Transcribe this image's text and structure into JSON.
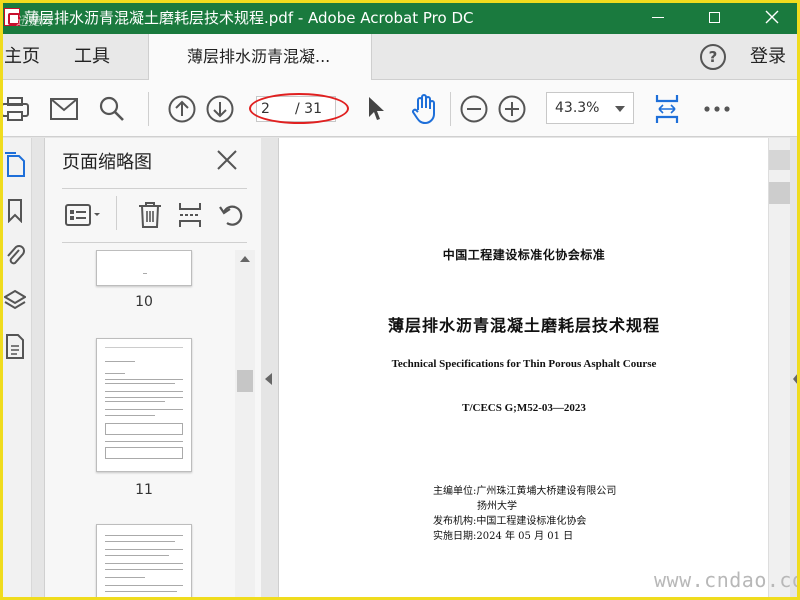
{
  "window": {
    "title": "薄层排水沥青混凝土磨耗层技术规程.pdf - Adobe Acrobat Pro DC",
    "logo_text": "迅捷网"
  },
  "menubar": {
    "home_label": "主页",
    "tools_label": "工具",
    "doc_tab_label": "薄层排水沥青混凝...",
    "help_label": "?",
    "login_label": "登录"
  },
  "toolbar": {
    "current_page": "2",
    "total_pages": "/ 31",
    "zoom": "43.3%"
  },
  "thumbnails_panel": {
    "title": "页面缩略图",
    "items": [
      {
        "label": "10"
      },
      {
        "label": "11"
      }
    ]
  },
  "document": {
    "line1": "中国工程建设标准化协会标准",
    "title_cn": "薄层排水沥青混凝土磨耗层技术规程",
    "title_en": "Technical Specifications for Thin Porous Asphalt Course",
    "code": "T/CECS G;M52-03—2023",
    "editor": "主编单位:广州珠江黄埔大桥建设有限公司",
    "editor2": "扬州大学",
    "publisher": "发布机构:中国工程建设标准化协会",
    "effective": "实施日期:2024 年 05 月 01 日"
  },
  "watermark": "www.cndao.com",
  "colors": {
    "titlebar": "#1a7a3e",
    "accent_blue": "#1e6fd9",
    "annotation_red": "#e02020",
    "frame_yellow": "#f0dc1e"
  }
}
